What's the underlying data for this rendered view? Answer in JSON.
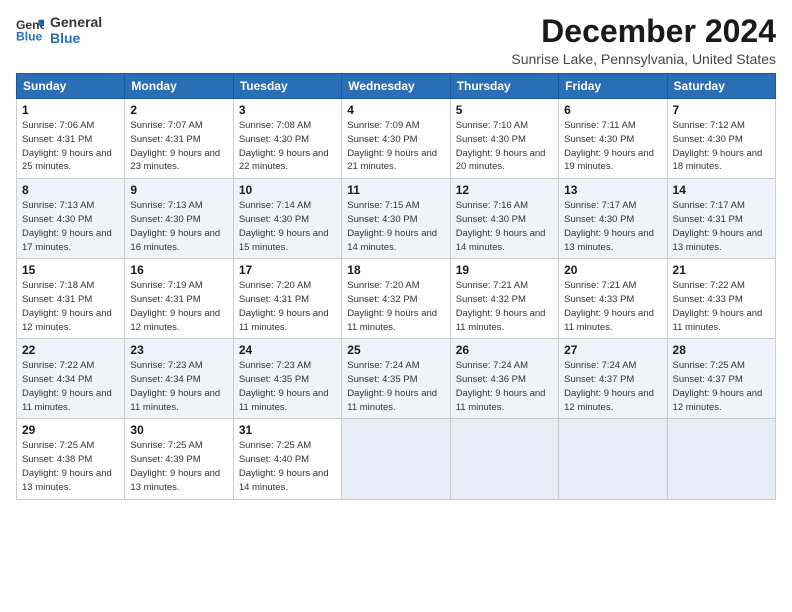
{
  "header": {
    "logo_line1": "General",
    "logo_line2": "Blue",
    "title": "December 2024",
    "subtitle": "Sunrise Lake, Pennsylvania, United States"
  },
  "weekdays": [
    "Sunday",
    "Monday",
    "Tuesday",
    "Wednesday",
    "Thursday",
    "Friday",
    "Saturday"
  ],
  "weeks": [
    [
      {
        "day": "1",
        "sunrise": "Sunrise: 7:06 AM",
        "sunset": "Sunset: 4:31 PM",
        "daylight": "Daylight: 9 hours and 25 minutes."
      },
      {
        "day": "2",
        "sunrise": "Sunrise: 7:07 AM",
        "sunset": "Sunset: 4:31 PM",
        "daylight": "Daylight: 9 hours and 23 minutes."
      },
      {
        "day": "3",
        "sunrise": "Sunrise: 7:08 AM",
        "sunset": "Sunset: 4:30 PM",
        "daylight": "Daylight: 9 hours and 22 minutes."
      },
      {
        "day": "4",
        "sunrise": "Sunrise: 7:09 AM",
        "sunset": "Sunset: 4:30 PM",
        "daylight": "Daylight: 9 hours and 21 minutes."
      },
      {
        "day": "5",
        "sunrise": "Sunrise: 7:10 AM",
        "sunset": "Sunset: 4:30 PM",
        "daylight": "Daylight: 9 hours and 20 minutes."
      },
      {
        "day": "6",
        "sunrise": "Sunrise: 7:11 AM",
        "sunset": "Sunset: 4:30 PM",
        "daylight": "Daylight: 9 hours and 19 minutes."
      },
      {
        "day": "7",
        "sunrise": "Sunrise: 7:12 AM",
        "sunset": "Sunset: 4:30 PM",
        "daylight": "Daylight: 9 hours and 18 minutes."
      }
    ],
    [
      {
        "day": "8",
        "sunrise": "Sunrise: 7:13 AM",
        "sunset": "Sunset: 4:30 PM",
        "daylight": "Daylight: 9 hours and 17 minutes."
      },
      {
        "day": "9",
        "sunrise": "Sunrise: 7:13 AM",
        "sunset": "Sunset: 4:30 PM",
        "daylight": "Daylight: 9 hours and 16 minutes."
      },
      {
        "day": "10",
        "sunrise": "Sunrise: 7:14 AM",
        "sunset": "Sunset: 4:30 PM",
        "daylight": "Daylight: 9 hours and 15 minutes."
      },
      {
        "day": "11",
        "sunrise": "Sunrise: 7:15 AM",
        "sunset": "Sunset: 4:30 PM",
        "daylight": "Daylight: 9 hours and 14 minutes."
      },
      {
        "day": "12",
        "sunrise": "Sunrise: 7:16 AM",
        "sunset": "Sunset: 4:30 PM",
        "daylight": "Daylight: 9 hours and 14 minutes."
      },
      {
        "day": "13",
        "sunrise": "Sunrise: 7:17 AM",
        "sunset": "Sunset: 4:30 PM",
        "daylight": "Daylight: 9 hours and 13 minutes."
      },
      {
        "day": "14",
        "sunrise": "Sunrise: 7:17 AM",
        "sunset": "Sunset: 4:31 PM",
        "daylight": "Daylight: 9 hours and 13 minutes."
      }
    ],
    [
      {
        "day": "15",
        "sunrise": "Sunrise: 7:18 AM",
        "sunset": "Sunset: 4:31 PM",
        "daylight": "Daylight: 9 hours and 12 minutes."
      },
      {
        "day": "16",
        "sunrise": "Sunrise: 7:19 AM",
        "sunset": "Sunset: 4:31 PM",
        "daylight": "Daylight: 9 hours and 12 minutes."
      },
      {
        "day": "17",
        "sunrise": "Sunrise: 7:20 AM",
        "sunset": "Sunset: 4:31 PM",
        "daylight": "Daylight: 9 hours and 11 minutes."
      },
      {
        "day": "18",
        "sunrise": "Sunrise: 7:20 AM",
        "sunset": "Sunset: 4:32 PM",
        "daylight": "Daylight: 9 hours and 11 minutes."
      },
      {
        "day": "19",
        "sunrise": "Sunrise: 7:21 AM",
        "sunset": "Sunset: 4:32 PM",
        "daylight": "Daylight: 9 hours and 11 minutes."
      },
      {
        "day": "20",
        "sunrise": "Sunrise: 7:21 AM",
        "sunset": "Sunset: 4:33 PM",
        "daylight": "Daylight: 9 hours and 11 minutes."
      },
      {
        "day": "21",
        "sunrise": "Sunrise: 7:22 AM",
        "sunset": "Sunset: 4:33 PM",
        "daylight": "Daylight: 9 hours and 11 minutes."
      }
    ],
    [
      {
        "day": "22",
        "sunrise": "Sunrise: 7:22 AM",
        "sunset": "Sunset: 4:34 PM",
        "daylight": "Daylight: 9 hours and 11 minutes."
      },
      {
        "day": "23",
        "sunrise": "Sunrise: 7:23 AM",
        "sunset": "Sunset: 4:34 PM",
        "daylight": "Daylight: 9 hours and 11 minutes."
      },
      {
        "day": "24",
        "sunrise": "Sunrise: 7:23 AM",
        "sunset": "Sunset: 4:35 PM",
        "daylight": "Daylight: 9 hours and 11 minutes."
      },
      {
        "day": "25",
        "sunrise": "Sunrise: 7:24 AM",
        "sunset": "Sunset: 4:35 PM",
        "daylight": "Daylight: 9 hours and 11 minutes."
      },
      {
        "day": "26",
        "sunrise": "Sunrise: 7:24 AM",
        "sunset": "Sunset: 4:36 PM",
        "daylight": "Daylight: 9 hours and 11 minutes."
      },
      {
        "day": "27",
        "sunrise": "Sunrise: 7:24 AM",
        "sunset": "Sunset: 4:37 PM",
        "daylight": "Daylight: 9 hours and 12 minutes."
      },
      {
        "day": "28",
        "sunrise": "Sunrise: 7:25 AM",
        "sunset": "Sunset: 4:37 PM",
        "daylight": "Daylight: 9 hours and 12 minutes."
      }
    ],
    [
      {
        "day": "29",
        "sunrise": "Sunrise: 7:25 AM",
        "sunset": "Sunset: 4:38 PM",
        "daylight": "Daylight: 9 hours and 13 minutes."
      },
      {
        "day": "30",
        "sunrise": "Sunrise: 7:25 AM",
        "sunset": "Sunset: 4:39 PM",
        "daylight": "Daylight: 9 hours and 13 minutes."
      },
      {
        "day": "31",
        "sunrise": "Sunrise: 7:25 AM",
        "sunset": "Sunset: 4:40 PM",
        "daylight": "Daylight: 9 hours and 14 minutes."
      },
      null,
      null,
      null,
      null
    ]
  ]
}
